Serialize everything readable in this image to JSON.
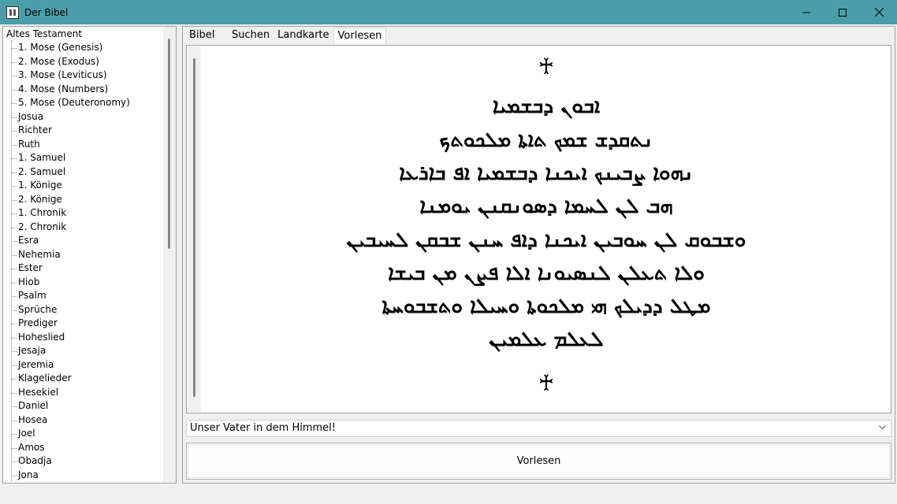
{
  "window": {
    "title": "Der Bibel",
    "minimize_icon": "minimize-icon",
    "maximize_icon": "maximize-icon",
    "close_icon": "close-icon"
  },
  "tree": {
    "root": "Altes Testament",
    "items": [
      "1. Mose (Genesis)",
      "2. Mose (Exodus)",
      "3. Mose (Leviticus)",
      "4. Mose (Numbers)",
      "5. Mose (Deuteronomy)",
      "Josua",
      "Richter",
      "Ruth",
      "1. Samuel",
      "2. Samuel",
      "1. Könige",
      "2. Könige",
      "1. Chronik",
      "2. Chronik",
      "Esra",
      "Nehemia",
      "Ester",
      "Hiob",
      "Psalm",
      "Sprüche",
      "Prediger",
      "Hoheslied",
      "Jesaja",
      "Jeremia",
      "Klagelieder",
      "Hesekiel",
      "Daniel",
      "Hosea",
      "Joel",
      "Amos",
      "Obadja",
      "Jona"
    ]
  },
  "tabs": {
    "bibel": "Bibel",
    "suchen": "Suchen",
    "landkarte": "Landkarte",
    "vorlesen": "Vorlesen"
  },
  "content": {
    "cross_top": "♰",
    "cross_bottom": "♰",
    "lines": [
      "ܐܒܘܢ ܕܒܫܡܝܐ",
      "ܢܬܩܕܫ ܫܡܟ ܬܐܬܐ ܡܠܟܘܬܟ",
      "ܢܗܘܐ ܨܒܝܢܟ ܐܝܟܢܐ ܕܒܫܡܝܐ ܐܦ ܒܐܪܥܐ",
      "ܗܒ ܠܢ ܠܚܡܐ ܕܣܘܢܩܢܢ ܝܘܡܢܐ",
      "ܘܫܒܘܩ ܠܢ ܚܘܒܝܢ ܐܝܟܢܐ ܕܐܦ ܚܢܢ ܫܒܩܢ ܠܚܝܒܝܢ",
      "ܘܠܐ ܬܥܠܢ ܠܢܣܝܘܢܐ ܐܠܐ ܦܨܢ ܡܢ ܒܝܫܐ",
      "ܡܛܠ ܕܕܝܠܟ ܗܝ ܡܠܟܘܬܐ ܘܚܝܠܐ ܘܬܫܒܘܚܬܐ",
      "ܠܥܠܡ ܥܠܡܝܢ"
    ]
  },
  "dropdown": {
    "value": "Unser Vater in dem Himmel!"
  },
  "button": {
    "label": "Vorlesen"
  }
}
